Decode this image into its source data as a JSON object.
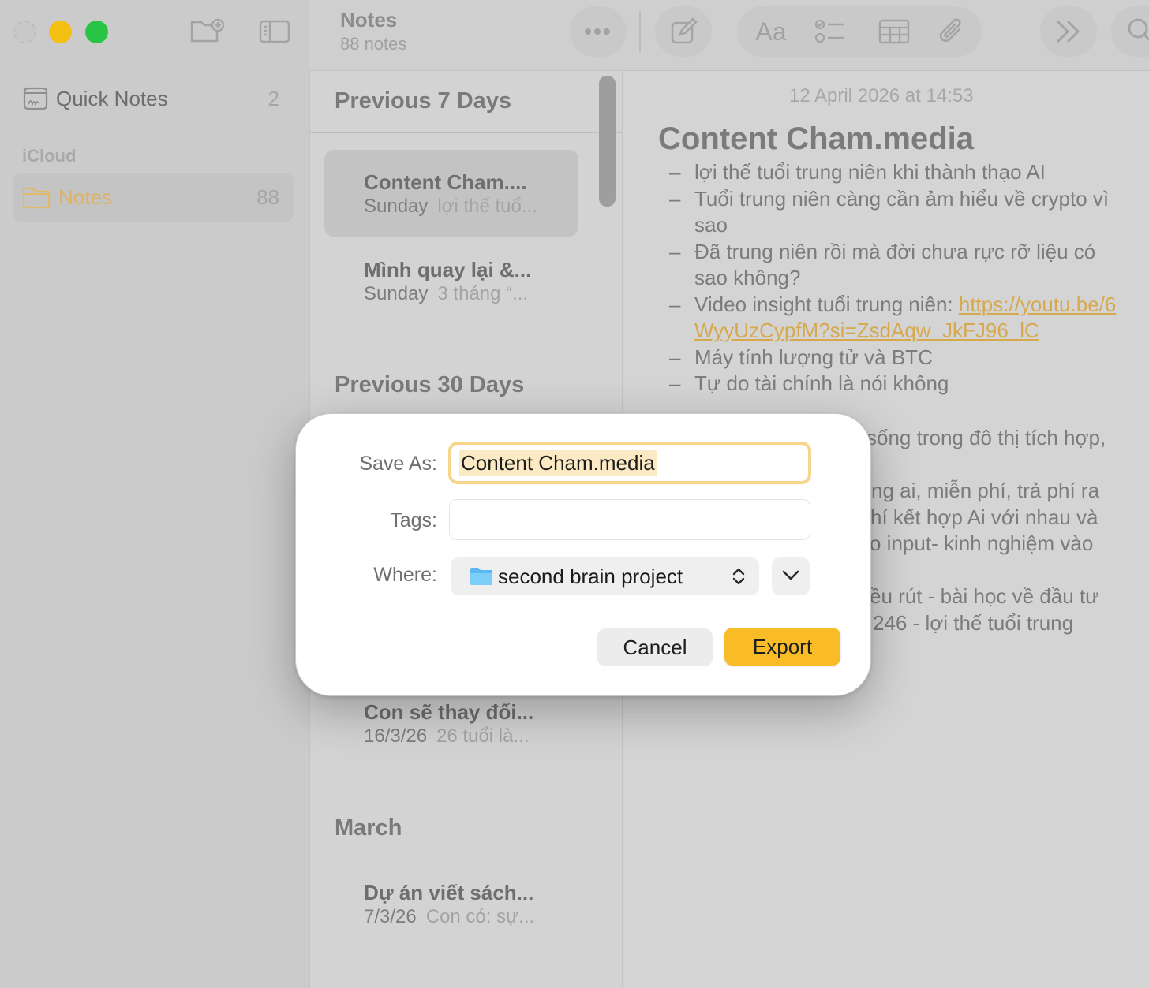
{
  "app": {
    "title": "Notes",
    "subtitle": "88 notes"
  },
  "sidebar": {
    "quick_notes": {
      "label": "Quick Notes",
      "count": "2"
    },
    "group_label": "iCloud",
    "notes_folder": {
      "label": "Notes",
      "count": "88"
    }
  },
  "toolbar": {
    "format_label": "Aa"
  },
  "list": {
    "sections": [
      {
        "heading": "Previous 7 Days"
      },
      {
        "heading": "Previous 30 Days"
      },
      {
        "heading": "March"
      }
    ],
    "notes": [
      {
        "title": "Content Cham....",
        "date": "Sunday",
        "preview": "lợi thế tuổ..."
      },
      {
        "title": "Mình quay lại &...",
        "date": "Sunday",
        "preview": "3 tháng “..."
      },
      {
        "title": "Con sẽ thay đổi...",
        "date": "16/3/26",
        "preview": "26 tuổi là..."
      },
      {
        "title": "Dự án viết sách...",
        "date": "7/3/26",
        "preview": "Con có: sự..."
      }
    ]
  },
  "editor": {
    "date": "12 April 2026 at 14:53",
    "title": "Content Cham.media",
    "bullets": [
      "lợi thế tuổi trung niên khi thành thạo AI",
      "Tuổi trung niên càng cần ảm hiểu về crypto vì sao",
      "Đã trung niên rồi mà đời chưa rực rỡ liệu có sao không?",
      "Video insight tuổi trung niên: ",
      "Máy tính lượng tử và BTC",
      "Tự do tài chính là nói không"
    ],
    "link": "https://youtu.be/6WyyUzCypfM?si=ZsdAqw_JkFJ96_lC",
    "fragments": [
      "sống trong đô thị tích hợp,",
      "ng ai, miễn phí, trả phí ra",
      "hí kết hợp Ai với nhau và",
      "o input- kinh nghiệm vào",
      "ều rút - bài học về đầu tư",
      "246 - lợi thế tuổi trung"
    ]
  },
  "dialog": {
    "save_as_label": "Save As:",
    "save_as_value": "Content Cham.media",
    "tags_label": "Tags:",
    "tags_value": "",
    "where_label": "Where:",
    "where_value": "second brain project",
    "cancel_label": "Cancel",
    "export_label": "Export"
  },
  "colors": {
    "accent": "#f9bc27",
    "focus_ring": "#f7d58b",
    "link": "#d7a94f",
    "traffic_min": "#f6bf13",
    "traffic_max": "#28c444"
  }
}
